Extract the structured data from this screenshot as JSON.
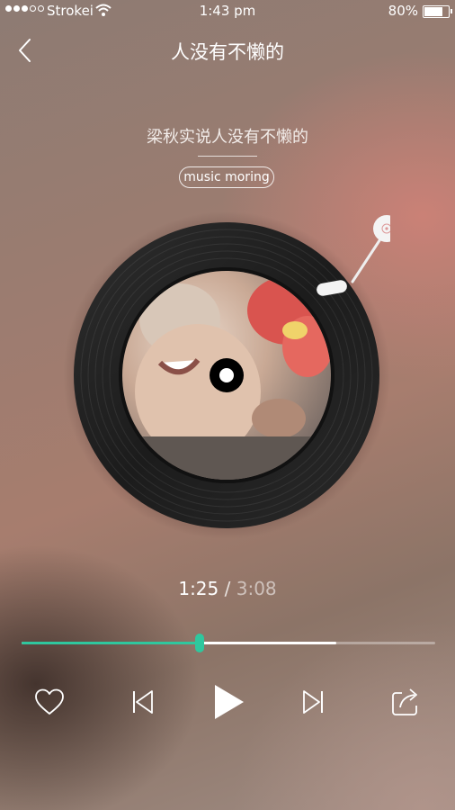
{
  "status_bar": {
    "carrier": "Strokei",
    "time": "1:43 pm",
    "battery_text": "80%",
    "battery_level": 0.8,
    "signal_bars_filled": 3,
    "signal_bars_total": 5
  },
  "nav": {
    "title": "人没有不懒的",
    "back_icon": "chevron-left-icon"
  },
  "song": {
    "title": "梁秋实说人没有不懒的",
    "album": "music moring"
  },
  "playback": {
    "current_time": "1:25",
    "separator": "/",
    "total_time": "3:08",
    "progress_fraction": 0.43,
    "buffered_fraction": 0.76
  },
  "controls": {
    "like_icon": "heart-icon",
    "previous_icon": "skip-previous-icon",
    "play_icon": "play-icon",
    "next_icon": "skip-next-icon",
    "share_icon": "share-icon"
  },
  "colors": {
    "accent": "#2fc79e",
    "vinyl": "#1c1c1c"
  }
}
